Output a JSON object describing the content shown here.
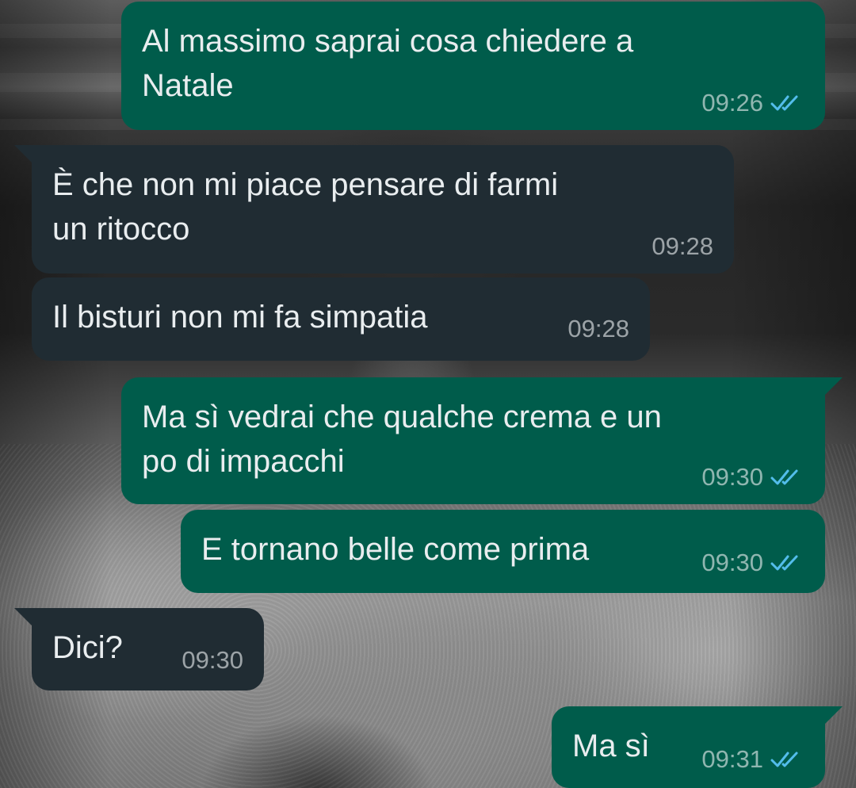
{
  "colors": {
    "outgoing_bubble": "#005c4b",
    "incoming_bubble": "#202c33",
    "text": "#e9edef",
    "read_ticks": "#53bdeb"
  },
  "messages": [
    {
      "direction": "outgoing",
      "text": "Al massimo saprai cosa chiedere a\nNatale",
      "time": "09:26",
      "status": "read",
      "status_icon": "double-check-icon"
    },
    {
      "direction": "incoming",
      "text": "È che non mi piace pensare di farmi\nun ritocco",
      "time": "09:28"
    },
    {
      "direction": "incoming",
      "text": "Il bisturi non mi fa simpatia",
      "time": "09:28"
    },
    {
      "direction": "outgoing",
      "text": "Ma sì vedrai che qualche crema e un\npo di impacchi",
      "time": "09:30",
      "status": "read",
      "status_icon": "double-check-icon"
    },
    {
      "direction": "outgoing",
      "text": "E tornano belle come prima",
      "time": "09:30",
      "status": "read",
      "status_icon": "double-check-icon"
    },
    {
      "direction": "incoming",
      "text": "Dici?",
      "time": "09:30"
    },
    {
      "direction": "outgoing",
      "text": "Ma sì",
      "time": "09:31",
      "status": "read",
      "status_icon": "double-check-icon"
    }
  ]
}
